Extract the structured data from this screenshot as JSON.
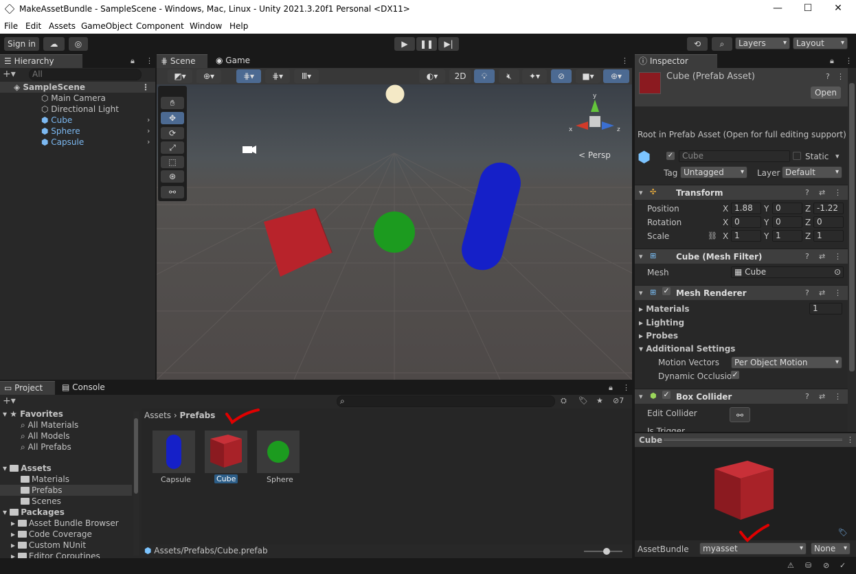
{
  "window": {
    "title": "MakeAssetBundle - SampleScene - Windows, Mac, Linux - Unity 2021.3.20f1 Personal <DX11>"
  },
  "menu": [
    "File",
    "Edit",
    "Assets",
    "GameObject",
    "Component",
    "Window",
    "Help"
  ],
  "toolbar": {
    "signin": "Sign in",
    "layers": "Layers",
    "layout": "Layout"
  },
  "hierarchy": {
    "tab": "Hierarchy",
    "search_placeholder": "All",
    "scene": "SampleScene",
    "items": [
      "Main Camera",
      "Directional Light",
      "Cube",
      "Sphere",
      "Capsule"
    ]
  },
  "scene": {
    "tab_scene": "Scene",
    "tab_game": "Game",
    "btn_2d": "2D",
    "persp": "< Persp"
  },
  "inspector": {
    "tab": "Inspector",
    "title": "Cube (Prefab Asset)",
    "open": "Open",
    "root_note": "Root in Prefab Asset (Open for full editing support)",
    "name": "Cube",
    "static": "Static",
    "tag_label": "Tag",
    "tag": "Untagged",
    "layer_label": "Layer",
    "layer": "Default",
    "transform": {
      "title": "Transform",
      "position": "Position",
      "rotation": "Rotation",
      "scale": "Scale",
      "pos": [
        "1.88",
        "0",
        "-1.22"
      ],
      "rot": [
        "0",
        "0",
        "0"
      ],
      "scl": [
        "1",
        "1",
        "1"
      ]
    },
    "meshfilter": {
      "title": "Cube (Mesh Filter)",
      "mesh_label": "Mesh",
      "mesh": "Cube"
    },
    "renderer": {
      "title": "Mesh Renderer",
      "materials": "Materials",
      "materials_count": "1",
      "lighting": "Lighting",
      "probes": "Probes",
      "additional": "Additional Settings",
      "motion_label": "Motion Vectors",
      "motion": "Per Object Motion",
      "occlusion": "Dynamic Occlusio"
    },
    "collider": {
      "title": "Box Collider",
      "edit": "Edit Collider",
      "trigger": "Is Trigger"
    },
    "preview": {
      "title": "Cube"
    },
    "assetbundle": {
      "label": "AssetBundle",
      "name": "myasset",
      "variant": "None"
    }
  },
  "project": {
    "tab_project": "Project",
    "tab_console": "Console",
    "favorites": "Favorites",
    "fav_items": [
      "All Materials",
      "All Models",
      "All Prefabs"
    ],
    "assets": "Assets",
    "asset_folders": [
      "Materials",
      "Prefabs",
      "Scenes"
    ],
    "packages": "Packages",
    "pkg_items": [
      "Asset Bundle Browser",
      "Code Coverage",
      "Custom NUnit",
      "Editor Coroutines"
    ],
    "crumb_root": "Assets",
    "crumb_leaf": "Prefabs",
    "files": [
      "Capsule",
      "Cube",
      "Sphere"
    ],
    "path": "Assets/Prefabs/Cube.prefab",
    "count": "7"
  },
  "colors": {
    "cube": "#b8232b",
    "sphere": "#1c9b1f",
    "capsule": "#1520c8",
    "annotation": "#e00000"
  }
}
